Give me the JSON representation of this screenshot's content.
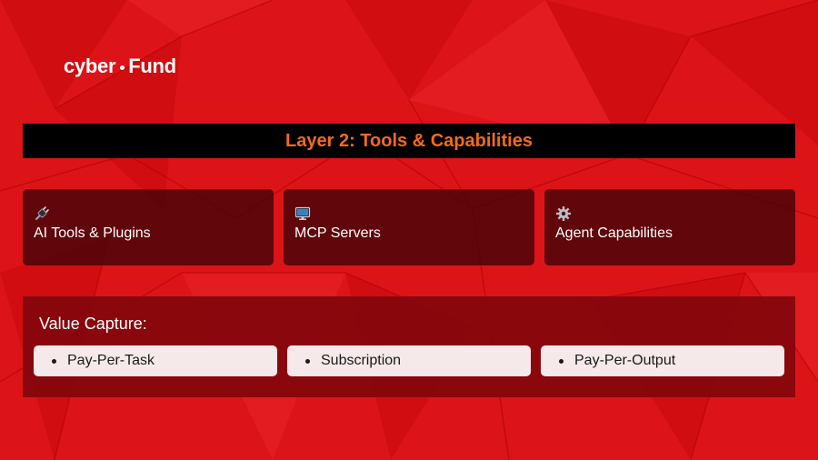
{
  "logo": {
    "left": "cyber",
    "right": "Fund"
  },
  "title": "Layer 2: Tools & Capabilities",
  "cards": [
    {
      "icon": "plug-icon",
      "label": "AI Tools & Plugins"
    },
    {
      "icon": "desktop-computer-icon",
      "label": "MCP Servers"
    },
    {
      "icon": "gear-icon",
      "label": "Agent Capabilities"
    }
  ],
  "value_capture": {
    "title": "Value Capture:",
    "items": [
      "Pay-Per-Task",
      "Subscription",
      "Pay-Per-Output"
    ]
  },
  "colors": {
    "background": "#dc1418",
    "title_text": "#f26b1d",
    "title_bar": "#000000",
    "card_bg": "#46040a",
    "value_box_bg": "#82060c",
    "pill_bg": "#f6e9ea"
  }
}
